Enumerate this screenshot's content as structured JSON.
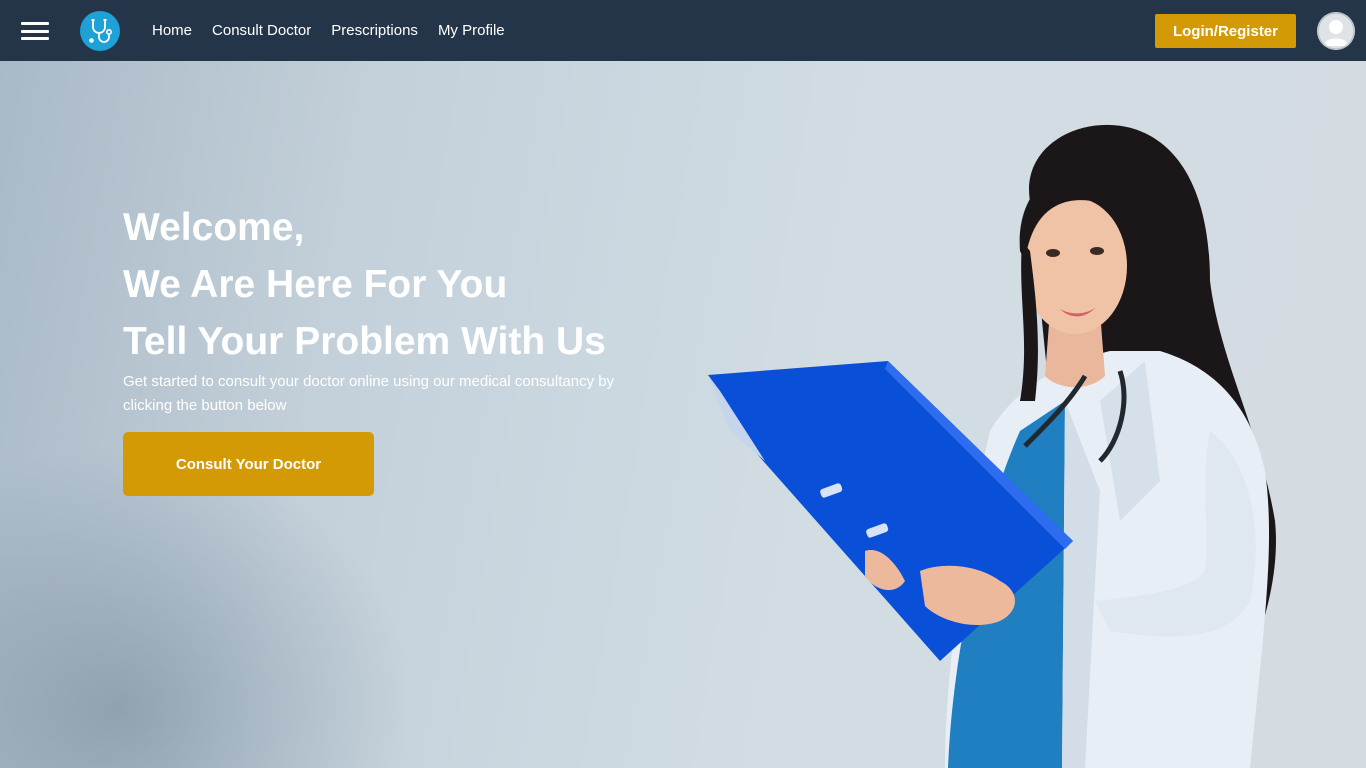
{
  "navbar": {
    "menu_icon": "hamburger-menu-icon",
    "logo_icon": "stethoscope-icon",
    "links": [
      "Home",
      "Consult Doctor",
      "Prescriptions",
      "My Profile"
    ],
    "login_label": "Login/Register",
    "avatar_icon": "user-avatar-icon",
    "background": "#253549",
    "accent": "#d39a06"
  },
  "hero": {
    "headline": [
      "Welcome,",
      "We Are Here For You",
      "Tell Your Problem With Us"
    ],
    "subtext": "Get started to consult your doctor online using our medical consultancy by clicking the button below",
    "cta_label": "Consult Your Doctor",
    "image": "doctor-holding-blue-folder-photo"
  }
}
